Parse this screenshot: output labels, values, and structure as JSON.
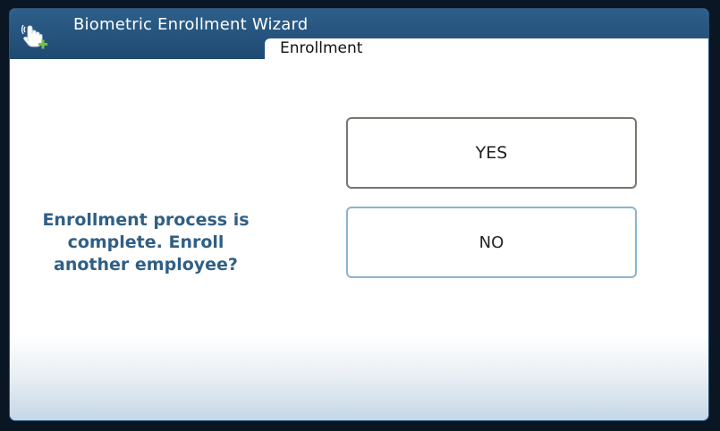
{
  "window": {
    "title": "Biometric Enrollment Wizard",
    "icon": "hand-pointer-plus-icon"
  },
  "tab": {
    "label": "Enrollment"
  },
  "prompt": {
    "message": "Enrollment process is complete. Enroll another employee?"
  },
  "buttons": {
    "yes_label": "YES",
    "no_label": "NO"
  },
  "colors": {
    "title_bar": "#1e4a72",
    "message_text": "#2f5f86",
    "yes_border": "#7a756f",
    "no_border": "#8bb4cf",
    "icon_plus": "#7ac143"
  }
}
